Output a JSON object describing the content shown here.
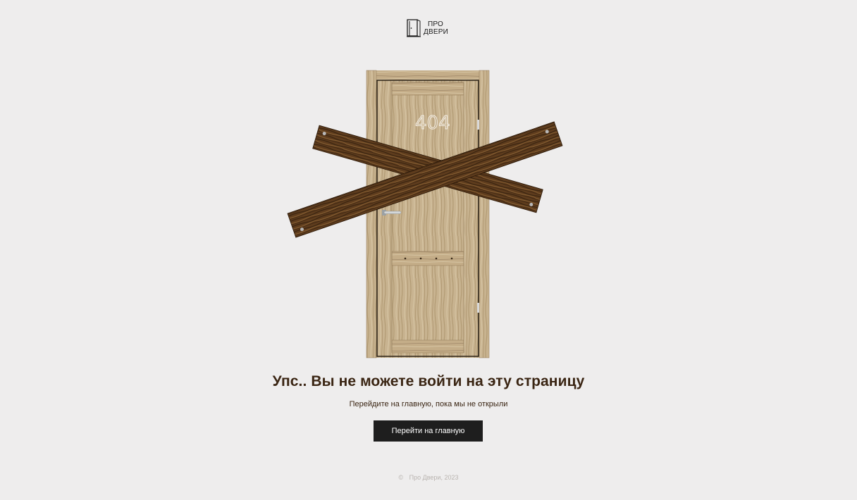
{
  "header": {
    "logo_line1": "ПРО",
    "logo_line2": "ДВЕРИ",
    "logo_icon": "door-icon"
  },
  "illustration": {
    "door_number": "404",
    "colors": {
      "door": "#c9b592",
      "boards": "#5a3a1c"
    }
  },
  "main": {
    "title": "Упс.. Вы не можете войти на эту страницу",
    "subtitle": "Перейдите на главную, пока мы не открыли",
    "button_label": "Перейти на главную"
  },
  "footer": {
    "copyright_symbol": "©",
    "copyright_text": "Про Двери, 2023"
  },
  "colors": {
    "background": "#eeeded",
    "title": "#3a2513",
    "button": "#1e1e1e",
    "footer_text": "#b9b4b0"
  }
}
